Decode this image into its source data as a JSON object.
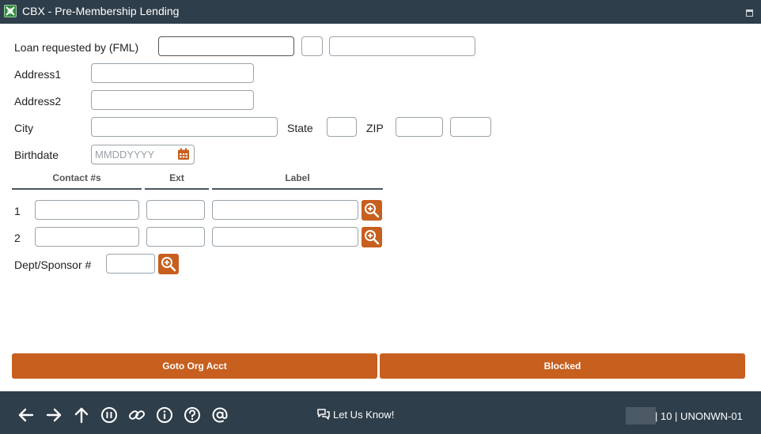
{
  "window": {
    "title": "CBX - Pre-Membership Lending"
  },
  "form": {
    "loan_requested_by_label": "Loan requested by (FML)",
    "loan_first_value": "",
    "loan_middle_value": "",
    "loan_last_value": "",
    "address1_label": "Address1",
    "address1_value": "",
    "address2_label": "Address2",
    "address2_value": "",
    "city_label": "City",
    "city_value": "",
    "state_label": "State",
    "state_value": "",
    "zip_label": "ZIP",
    "zip_value": "",
    "zip_ext_value": "",
    "birthdate_label": "Birthdate",
    "birthdate_placeholder": "MMDDYYYY",
    "birthdate_value": ""
  },
  "contacts": {
    "headers": {
      "contact": "Contact #s",
      "ext": "Ext",
      "label": "Label"
    },
    "rows": [
      {
        "index": "1",
        "contact": "",
        "ext": "",
        "label": ""
      },
      {
        "index": "2",
        "contact": "",
        "ext": "",
        "label": ""
      }
    ]
  },
  "dept": {
    "label": "Dept/Sponsor #",
    "value": ""
  },
  "actions": {
    "goto_org_acct": "Goto Org Acct",
    "blocked": "Blocked"
  },
  "footer": {
    "feedback": "Let Us Know!",
    "status": "| 10 | UNONWN-01",
    "icons": [
      "back-arrow-icon",
      "forward-arrow-icon",
      "up-arrow-icon",
      "pause-icon",
      "link-icon",
      "info-icon",
      "help-icon",
      "at-sign-icon"
    ]
  },
  "colors": {
    "accent": "#c75f1f",
    "chrome": "#2e3e4a"
  }
}
